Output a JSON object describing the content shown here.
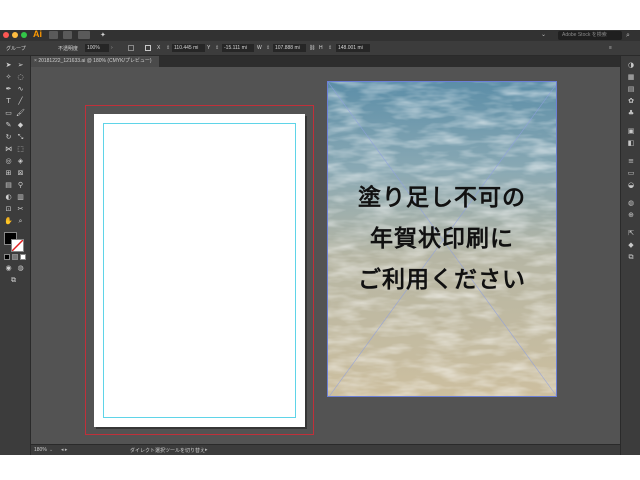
{
  "app": {
    "name": "Ai"
  },
  "search": {
    "placeholder": "Adobe Stock を検索"
  },
  "control_bar": {
    "selection_label": "グループ",
    "opacity_label": "不透明度",
    "opacity_value": "100%",
    "x_label": "X",
    "x_value": "110.445 mi",
    "y_label": "Y",
    "y_value": "-15.111 mi",
    "w_label": "W",
    "w_value": "107.888 mi",
    "h_label": "H",
    "h_value": "148.001 mi"
  },
  "document": {
    "tab_title": "20181222_121633.ai @ 180% (CMYK/プレビュー)"
  },
  "canvas": {
    "overlay_lines": [
      "塗り足し不可の",
      "年賀状印刷に",
      "ご利用ください"
    ]
  },
  "status_bar": {
    "zoom": "180%",
    "tool_hint": "ダイレクト選択ツールを切り替え"
  },
  "colors": {
    "bleed": "#c0303a",
    "margin_guide": "#5fd4e8",
    "selection": "#6b7fd6"
  }
}
